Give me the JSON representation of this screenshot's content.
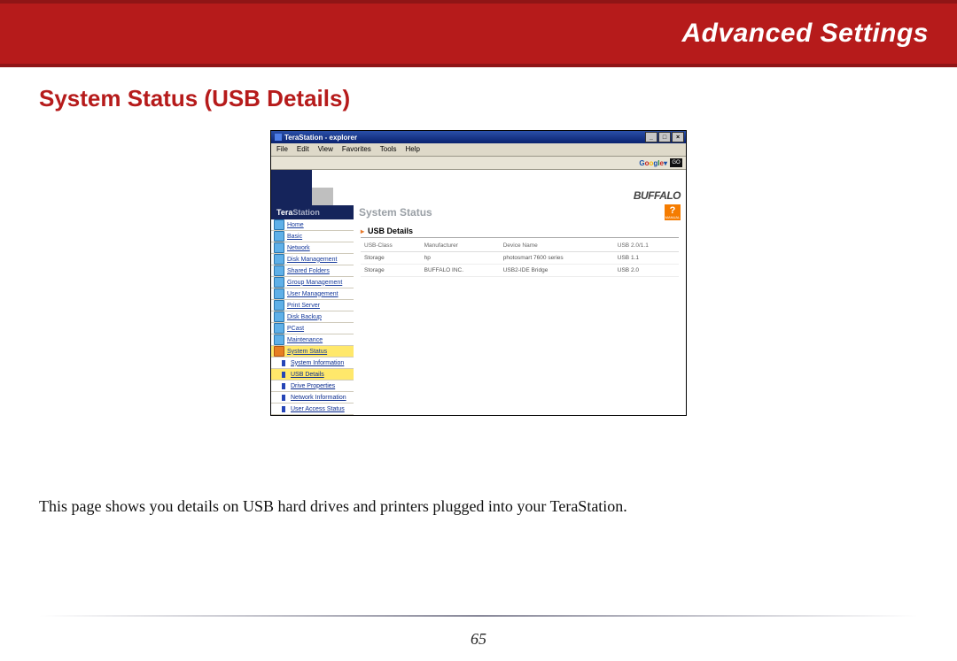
{
  "banner": {
    "title": "Advanced Settings"
  },
  "section": {
    "title": "System Status (USB Details)"
  },
  "caption": {
    "text": "This page shows you details on USB hard drives and printers plugged into your TeraStation."
  },
  "page_number": "65",
  "window": {
    "title": "TeraStation - explorer",
    "menus": [
      "File",
      "Edit",
      "View",
      "Favorites",
      "Tools",
      "Help"
    ],
    "google_letters": [
      "G",
      "o",
      "o",
      "g",
      "l",
      "e"
    ],
    "go_label": "GO"
  },
  "brand": {
    "tera": "Tera",
    "station": "Station",
    "buffalo": "BUFFALO"
  },
  "nav": {
    "items": [
      {
        "label": "Home"
      },
      {
        "label": "Basic"
      },
      {
        "label": "Network"
      },
      {
        "label": "Disk Management"
      },
      {
        "label": "Shared Folders"
      },
      {
        "label": "Group Management"
      },
      {
        "label": "User Management"
      },
      {
        "label": "Print Server"
      },
      {
        "label": "Disk Backup"
      },
      {
        "label": "PCast"
      },
      {
        "label": "Maintenance"
      },
      {
        "label": "System Status"
      }
    ],
    "subs": [
      {
        "label": "System Information"
      },
      {
        "label": "USB Details"
      },
      {
        "label": "Drive Properties"
      },
      {
        "label": "Network Information"
      },
      {
        "label": "User Access Status"
      }
    ]
  },
  "content": {
    "page_title": "System Status",
    "help_label": "MANUAL",
    "section_title": "USB Details",
    "table": {
      "headers": [
        "USB-Class",
        "Manufacturer",
        "Device Name",
        "USB 2.0/1.1"
      ],
      "rows": [
        [
          "Storage",
          "hp",
          "photosmart 7600 series",
          "USB 1.1"
        ],
        [
          "Storage",
          "BUFFALO INC.",
          "USB2-IDE Bridge",
          "USB 2.0"
        ]
      ]
    }
  }
}
